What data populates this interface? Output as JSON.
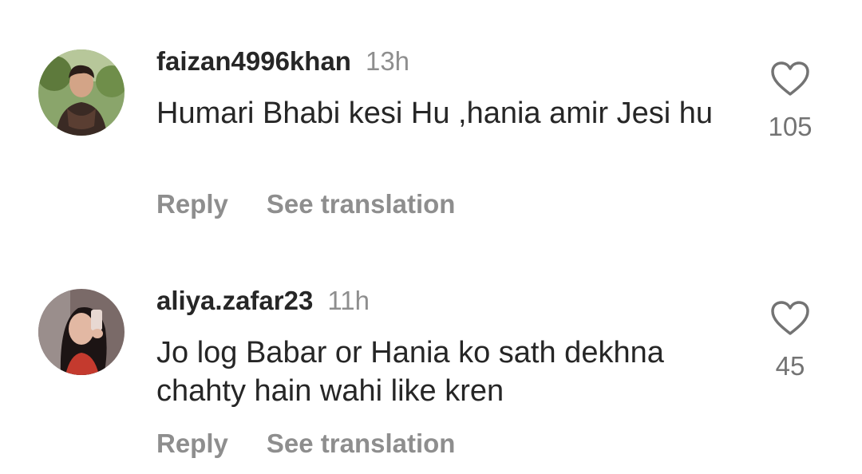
{
  "comments": [
    {
      "username": "faizan4996khan",
      "time": "13h",
      "text": "Humari Bhabi kesi Hu ,hania amir Jesi hu",
      "reply_label": "Reply",
      "translate_label": "See translation",
      "likes": "105",
      "avatar_icon": "profile-photo-man"
    },
    {
      "username": "aliya.zafar23",
      "time": "11h",
      "text": "Jo log Babar or Hania ko sath dekhna chahty hain wahi like kren",
      "reply_label": "Reply",
      "translate_label": "See translation",
      "likes": "45",
      "avatar_icon": "profile-photo-woman"
    }
  ],
  "colors": {
    "primary_text": "#262626",
    "secondary_text": "#8e8e8e",
    "background": "#ffffff"
  }
}
